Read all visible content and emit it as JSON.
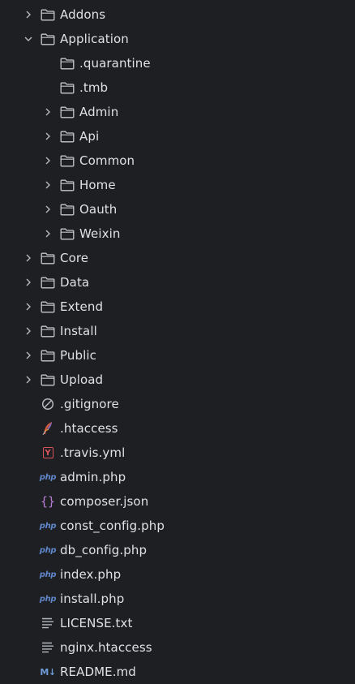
{
  "colors": {
    "background": "#1e1f22",
    "text": "#dfe1e5",
    "folder": "#c5c7cb",
    "php": "#5f86c9",
    "json": "#b77ed6",
    "yaml": "#d9535b",
    "markdown": "#6e9bd8"
  },
  "tree": [
    {
      "label": "Addons",
      "depth": 0,
      "type": "folder",
      "expander": "collapsed"
    },
    {
      "label": "Application",
      "depth": 0,
      "type": "folder",
      "expander": "expanded"
    },
    {
      "label": ".quarantine",
      "depth": 1,
      "type": "folder",
      "expander": "none"
    },
    {
      "label": ".tmb",
      "depth": 1,
      "type": "folder",
      "expander": "none"
    },
    {
      "label": "Admin",
      "depth": 1,
      "type": "folder",
      "expander": "collapsed"
    },
    {
      "label": "Api",
      "depth": 1,
      "type": "folder",
      "expander": "collapsed"
    },
    {
      "label": "Common",
      "depth": 1,
      "type": "folder",
      "expander": "collapsed"
    },
    {
      "label": "Home",
      "depth": 1,
      "type": "folder",
      "expander": "collapsed"
    },
    {
      "label": "Oauth",
      "depth": 1,
      "type": "folder",
      "expander": "collapsed"
    },
    {
      "label": "Weixin",
      "depth": 1,
      "type": "folder",
      "expander": "collapsed"
    },
    {
      "label": "Core",
      "depth": 0,
      "type": "folder",
      "expander": "collapsed"
    },
    {
      "label": "Data",
      "depth": 0,
      "type": "folder",
      "expander": "collapsed"
    },
    {
      "label": "Extend",
      "depth": 0,
      "type": "folder",
      "expander": "collapsed"
    },
    {
      "label": "Install",
      "depth": 0,
      "type": "folder",
      "expander": "collapsed"
    },
    {
      "label": "Public",
      "depth": 0,
      "type": "folder",
      "expander": "collapsed"
    },
    {
      "label": "Upload",
      "depth": 0,
      "type": "folder",
      "expander": "collapsed"
    },
    {
      "label": ".gitignore",
      "depth": 0,
      "type": "file",
      "icon": "ignore-icon"
    },
    {
      "label": ".htaccess",
      "depth": 0,
      "type": "file",
      "icon": "apache-feather-icon"
    },
    {
      "label": ".travis.yml",
      "depth": 0,
      "type": "file",
      "icon": "yaml-icon",
      "icon_text": "Y"
    },
    {
      "label": "admin.php",
      "depth": 0,
      "type": "file",
      "icon": "php-icon",
      "icon_text": "php"
    },
    {
      "label": "composer.json",
      "depth": 0,
      "type": "file",
      "icon": "json-icon",
      "icon_text": "{}"
    },
    {
      "label": "const_config.php",
      "depth": 0,
      "type": "file",
      "icon": "php-icon",
      "icon_text": "php"
    },
    {
      "label": "db_config.php",
      "depth": 0,
      "type": "file",
      "icon": "php-icon",
      "icon_text": "php"
    },
    {
      "label": "index.php",
      "depth": 0,
      "type": "file",
      "icon": "php-icon",
      "icon_text": "php"
    },
    {
      "label": "install.php",
      "depth": 0,
      "type": "file",
      "icon": "php-icon",
      "icon_text": "php"
    },
    {
      "label": "LICENSE.txt",
      "depth": 0,
      "type": "file",
      "icon": "text-file-icon"
    },
    {
      "label": "nginx.htaccess",
      "depth": 0,
      "type": "file",
      "icon": "text-file-icon"
    },
    {
      "label": "README.md",
      "depth": 0,
      "type": "file",
      "icon": "markdown-icon",
      "icon_text": "M↓"
    }
  ]
}
